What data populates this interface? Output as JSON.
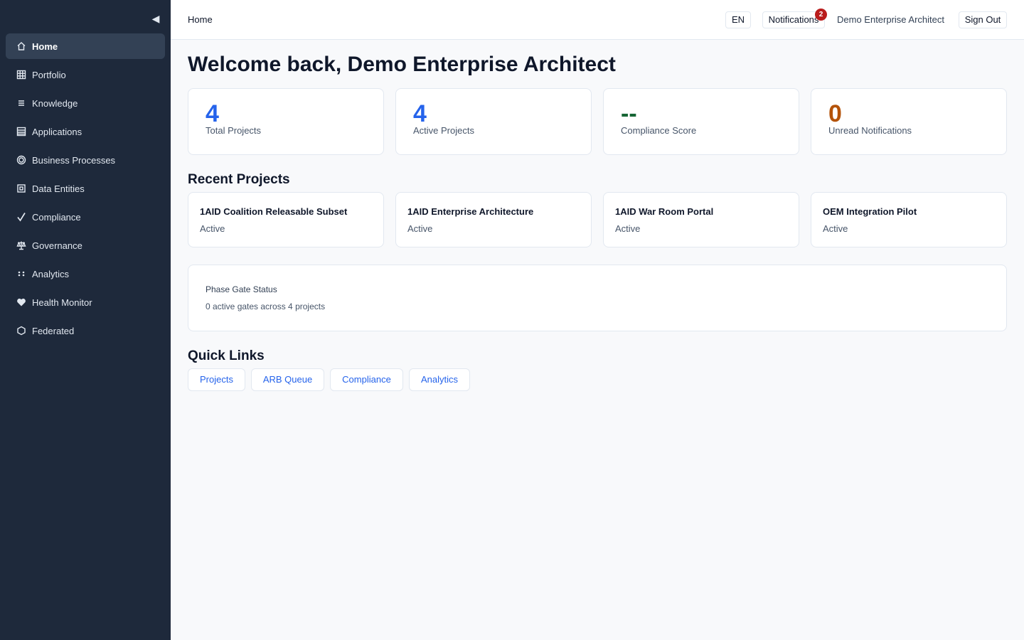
{
  "sidebar": {
    "collapse_icon": "◀",
    "items": [
      {
        "label": "Home",
        "icon": "home-icon"
      },
      {
        "label": "Portfolio",
        "icon": "grid-icon"
      },
      {
        "label": "Knowledge",
        "icon": "list-icon"
      },
      {
        "label": "Applications",
        "icon": "table-icon"
      },
      {
        "label": "Business Processes",
        "icon": "target-icon"
      },
      {
        "label": "Data Entities",
        "icon": "entity-icon"
      },
      {
        "label": "Compliance",
        "icon": "check-icon"
      },
      {
        "label": "Governance",
        "icon": "scales-icon"
      },
      {
        "label": "Analytics",
        "icon": "dots-icon"
      },
      {
        "label": "Health Monitor",
        "icon": "heart-icon"
      },
      {
        "label": "Federated",
        "icon": "hexagon-icon"
      }
    ]
  },
  "header": {
    "breadcrumb": "Home",
    "language": "EN",
    "notifications_label": "Notifications",
    "notifications_count": "2",
    "user_name": "Demo Enterprise Architect",
    "sign_out": "Sign Out"
  },
  "main": {
    "welcome": "Welcome back, Demo Enterprise Architect",
    "stats": [
      {
        "value": "4",
        "label": "Total Projects",
        "color": "#2563eb"
      },
      {
        "value": "4",
        "label": "Active Projects",
        "color": "#2563eb"
      },
      {
        "value": "--",
        "label": "Compliance Score",
        "color": "#166534"
      },
      {
        "value": "0",
        "label": "Unread Notifications",
        "color": "#b45309"
      }
    ],
    "recent_projects_title": "Recent Projects",
    "projects": [
      {
        "name": "1AID Coalition Releasable Subset",
        "status": "Active"
      },
      {
        "name": "1AID Enterprise Architecture",
        "status": "Active"
      },
      {
        "name": "1AID War Room Portal",
        "status": "Active"
      },
      {
        "name": "OEM Integration Pilot",
        "status": "Active"
      }
    ],
    "phase_gate": {
      "title": "Phase Gate Status",
      "description": "0 active gates across 4 projects"
    },
    "quick_links_title": "Quick Links",
    "quick_links": [
      "Projects",
      "ARB Queue",
      "Compliance",
      "Analytics"
    ]
  }
}
